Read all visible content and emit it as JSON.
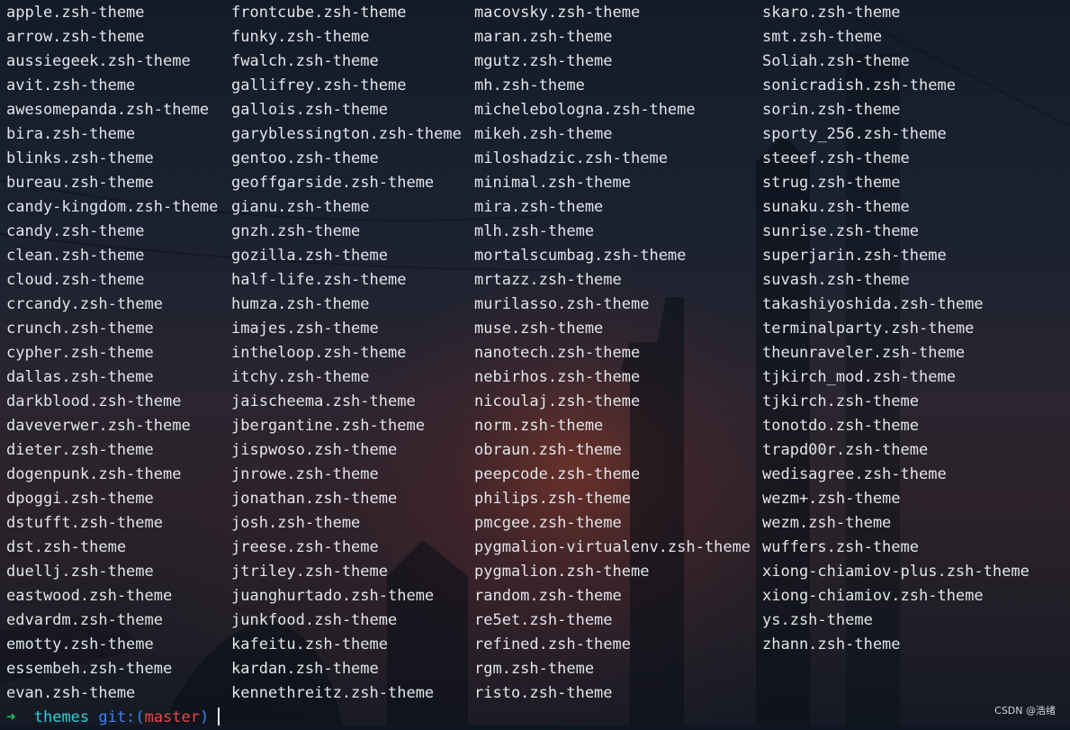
{
  "terminal": {
    "columns": [
      [
        "apple.zsh-theme",
        "arrow.zsh-theme",
        "aussiegeek.zsh-theme",
        "avit.zsh-theme",
        "awesomepanda.zsh-theme",
        "bira.zsh-theme",
        "blinks.zsh-theme",
        "bureau.zsh-theme",
        "candy-kingdom.zsh-theme",
        "candy.zsh-theme",
        "clean.zsh-theme",
        "cloud.zsh-theme",
        "crcandy.zsh-theme",
        "crunch.zsh-theme",
        "cypher.zsh-theme",
        "dallas.zsh-theme",
        "darkblood.zsh-theme",
        "daveverwer.zsh-theme",
        "dieter.zsh-theme",
        "dogenpunk.zsh-theme",
        "dpoggi.zsh-theme",
        "dstufft.zsh-theme",
        "dst.zsh-theme",
        "duellj.zsh-theme",
        "eastwood.zsh-theme",
        "edvardm.zsh-theme",
        "emotty.zsh-theme",
        "essembeh.zsh-theme",
        "evan.zsh-theme"
      ],
      [
        "frontcube.zsh-theme",
        "funky.zsh-theme",
        "fwalch.zsh-theme",
        "gallifrey.zsh-theme",
        "gallois.zsh-theme",
        "garyblessington.zsh-theme",
        "gentoo.zsh-theme",
        "geoffgarside.zsh-theme",
        "gianu.zsh-theme",
        "gnzh.zsh-theme",
        "gozilla.zsh-theme",
        "half-life.zsh-theme",
        "humza.zsh-theme",
        "imajes.zsh-theme",
        "intheloop.zsh-theme",
        "itchy.zsh-theme",
        "jaischeema.zsh-theme",
        "jbergantine.zsh-theme",
        "jispwoso.zsh-theme",
        "jnrowe.zsh-theme",
        "jonathan.zsh-theme",
        "josh.zsh-theme",
        "jreese.zsh-theme",
        "jtriley.zsh-theme",
        "juanghurtado.zsh-theme",
        "junkfood.zsh-theme",
        "kafeitu.zsh-theme",
        "kardan.zsh-theme",
        "kennethreitz.zsh-theme"
      ],
      [
        "macovsky.zsh-theme",
        "maran.zsh-theme",
        "mgutz.zsh-theme",
        "mh.zsh-theme",
        "michelebologna.zsh-theme",
        "mikeh.zsh-theme",
        "miloshadzic.zsh-theme",
        "minimal.zsh-theme",
        "mira.zsh-theme",
        "mlh.zsh-theme",
        "mortalscumbag.zsh-theme",
        "mrtazz.zsh-theme",
        "murilasso.zsh-theme",
        "muse.zsh-theme",
        "nanotech.zsh-theme",
        "nebirhos.zsh-theme",
        "nicoulaj.zsh-theme",
        "norm.zsh-theme",
        "obraun.zsh-theme",
        "peepcode.zsh-theme",
        "philips.zsh-theme",
        "pmcgee.zsh-theme",
        "pygmalion-virtualenv.zsh-theme",
        "pygmalion.zsh-theme",
        "random.zsh-theme",
        "re5et.zsh-theme",
        "refined.zsh-theme",
        "rgm.zsh-theme",
        "risto.zsh-theme"
      ],
      [
        "skaro.zsh-theme",
        "smt.zsh-theme",
        "Soliah.zsh-theme",
        "sonicradish.zsh-theme",
        "sorin.zsh-theme",
        "sporty_256.zsh-theme",
        "steeef.zsh-theme",
        "strug.zsh-theme",
        "sunaku.zsh-theme",
        "sunrise.zsh-theme",
        "superjarin.zsh-theme",
        "suvash.zsh-theme",
        "takashiyoshida.zsh-theme",
        "terminalparty.zsh-theme",
        "theunraveler.zsh-theme",
        "tjkirch_mod.zsh-theme",
        "tjkirch.zsh-theme",
        "tonotdo.zsh-theme",
        "trapd00r.zsh-theme",
        "wedisagree.zsh-theme",
        "wezm+.zsh-theme",
        "wezm.zsh-theme",
        "wuffers.zsh-theme",
        "xiong-chiamiov-plus.zsh-theme",
        "xiong-chiamiov.zsh-theme",
        "ys.zsh-theme",
        "zhann.zsh-theme"
      ]
    ]
  },
  "prompt": {
    "arrow": "➜",
    "directory": "themes",
    "git_label": "git:(",
    "branch": "master",
    "git_close": ")"
  },
  "watermark": "CSDN @浩绪",
  "colors": {
    "text": "#e2e5ea",
    "prompt_arrow": "#22c55e",
    "prompt_directory": "#2fd2d9",
    "git_label": "#3b82f6",
    "branch": "#ef4444"
  }
}
